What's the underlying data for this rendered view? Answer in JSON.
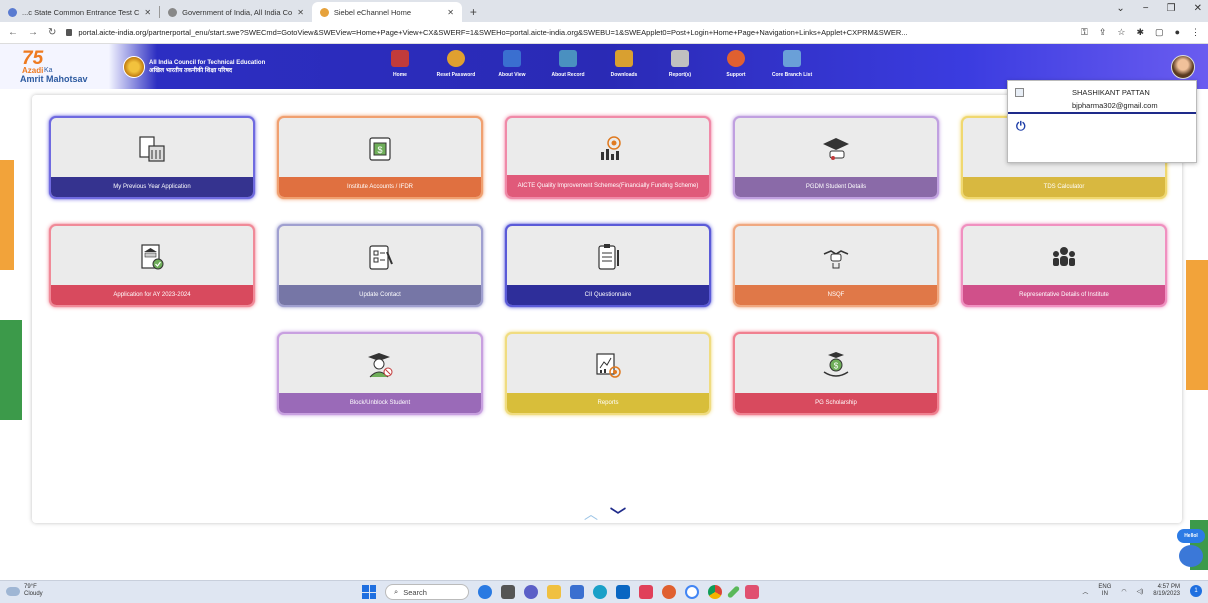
{
  "browser": {
    "tabs": [
      {
        "title": "...c State Common Entrance Test C",
        "active": false
      },
      {
        "title": "Government of India, All India Co",
        "active": false
      },
      {
        "title": "Siebel eChannel Home",
        "active": true
      }
    ],
    "new_tab": "+",
    "url": "portal.aicte-india.org/partnerportal_enu/start.swe?SWECmd=GotoView&SWEView=Home+Page+View+CX&SWERF=1&SWEHo=portal.aicte-india.org&SWEBU=1&SWEApplet0=Post+Login+Home+Page+Navigation+Links+Applet+CXPRM&SWER..."
  },
  "header": {
    "azadi_75": "75",
    "azadi_word": "Azadi",
    "azadi_ka": "Ka",
    "amrit_mahotsav": "Amrit Mahotsav",
    "org_name_en": "All India Council for Technical Education",
    "org_name_hi": "अखिल भारतीय तकनीकी शिक्षा परिषद",
    "nav": [
      {
        "label": "Home",
        "color": "#c23b3b"
      },
      {
        "label": "Reset Password",
        "color": "#e0a030"
      },
      {
        "label": "About View",
        "color": "#3a6fd0"
      },
      {
        "label": "About Record",
        "color": "#4a90c0"
      },
      {
        "label": "Downloads",
        "color": "#d9a030"
      },
      {
        "label": "Report(s)",
        "color": "#c0c0c0"
      },
      {
        "label": "Support",
        "color": "#e06030"
      },
      {
        "label": "Core Branch List",
        "color": "#6aa0d8"
      }
    ]
  },
  "user_popup": {
    "name": "SHASHIKANT PATTAN",
    "email": "bjpharma302@gmail.com",
    "logout_icon": "⏻"
  },
  "tiles": [
    {
      "label": "My Previous Year Application",
      "bar": "#35338f",
      "glow": "#6f6ae0",
      "icon": "🏛"
    },
    {
      "label": "Institute Accounts / IFDR",
      "bar": "#e07040",
      "glow": "#f0a070",
      "icon": "💵"
    },
    {
      "label": "AICTE Quality Improvement Schemes(Financially Funding Scheme)",
      "bar": "#e05a7a",
      "glow": "#f08aa8",
      "icon": "📊"
    },
    {
      "label": "PGDM Student Details",
      "bar": "#8a6aa8",
      "glow": "#c0a0e0",
      "icon": "🎓"
    },
    {
      "label": "TDS Calculator",
      "bar": "#d8b840",
      "glow": "#f0d870",
      "icon": "🧮"
    },
    {
      "label": "Application for AY 2023-2024",
      "bar": "#d84a5e",
      "glow": "#f08a98",
      "icon": "🏦"
    },
    {
      "label": "Update Contact",
      "bar": "#7676a6",
      "glow": "#a0a0d0",
      "icon": "📋"
    },
    {
      "label": "CII Questionnaire",
      "bar": "#2e2e9a",
      "glow": "#5a5ad8",
      "icon": "📝"
    },
    {
      "label": "NSQF",
      "bar": "#e07848",
      "glow": "#f0a880",
      "icon": "🤝"
    },
    {
      "label": "Representative Details of Institute",
      "bar": "#d0508a",
      "glow": "#f090c0",
      "icon": "👥"
    },
    {
      "label": "Block/Unblock Student",
      "bar": "#9a6ab8",
      "glow": "#c8a0e0",
      "icon": "🎓"
    },
    {
      "label": "Reports",
      "bar": "#d8be3a",
      "glow": "#f0dc80",
      "icon": "📈"
    },
    {
      "label": "PG Scholarship",
      "bar": "#d84a5e",
      "glow": "#f08090",
      "icon": "💰"
    }
  ],
  "chatbot": {
    "label": "HelloI"
  },
  "taskbar": {
    "temp": "79°F",
    "weather": "Cloudy",
    "search_placeholder": "Search",
    "lang": "ENG",
    "region": "IN",
    "time": "4:57 PM",
    "date": "8/19/2023",
    "notif_count": "1"
  }
}
